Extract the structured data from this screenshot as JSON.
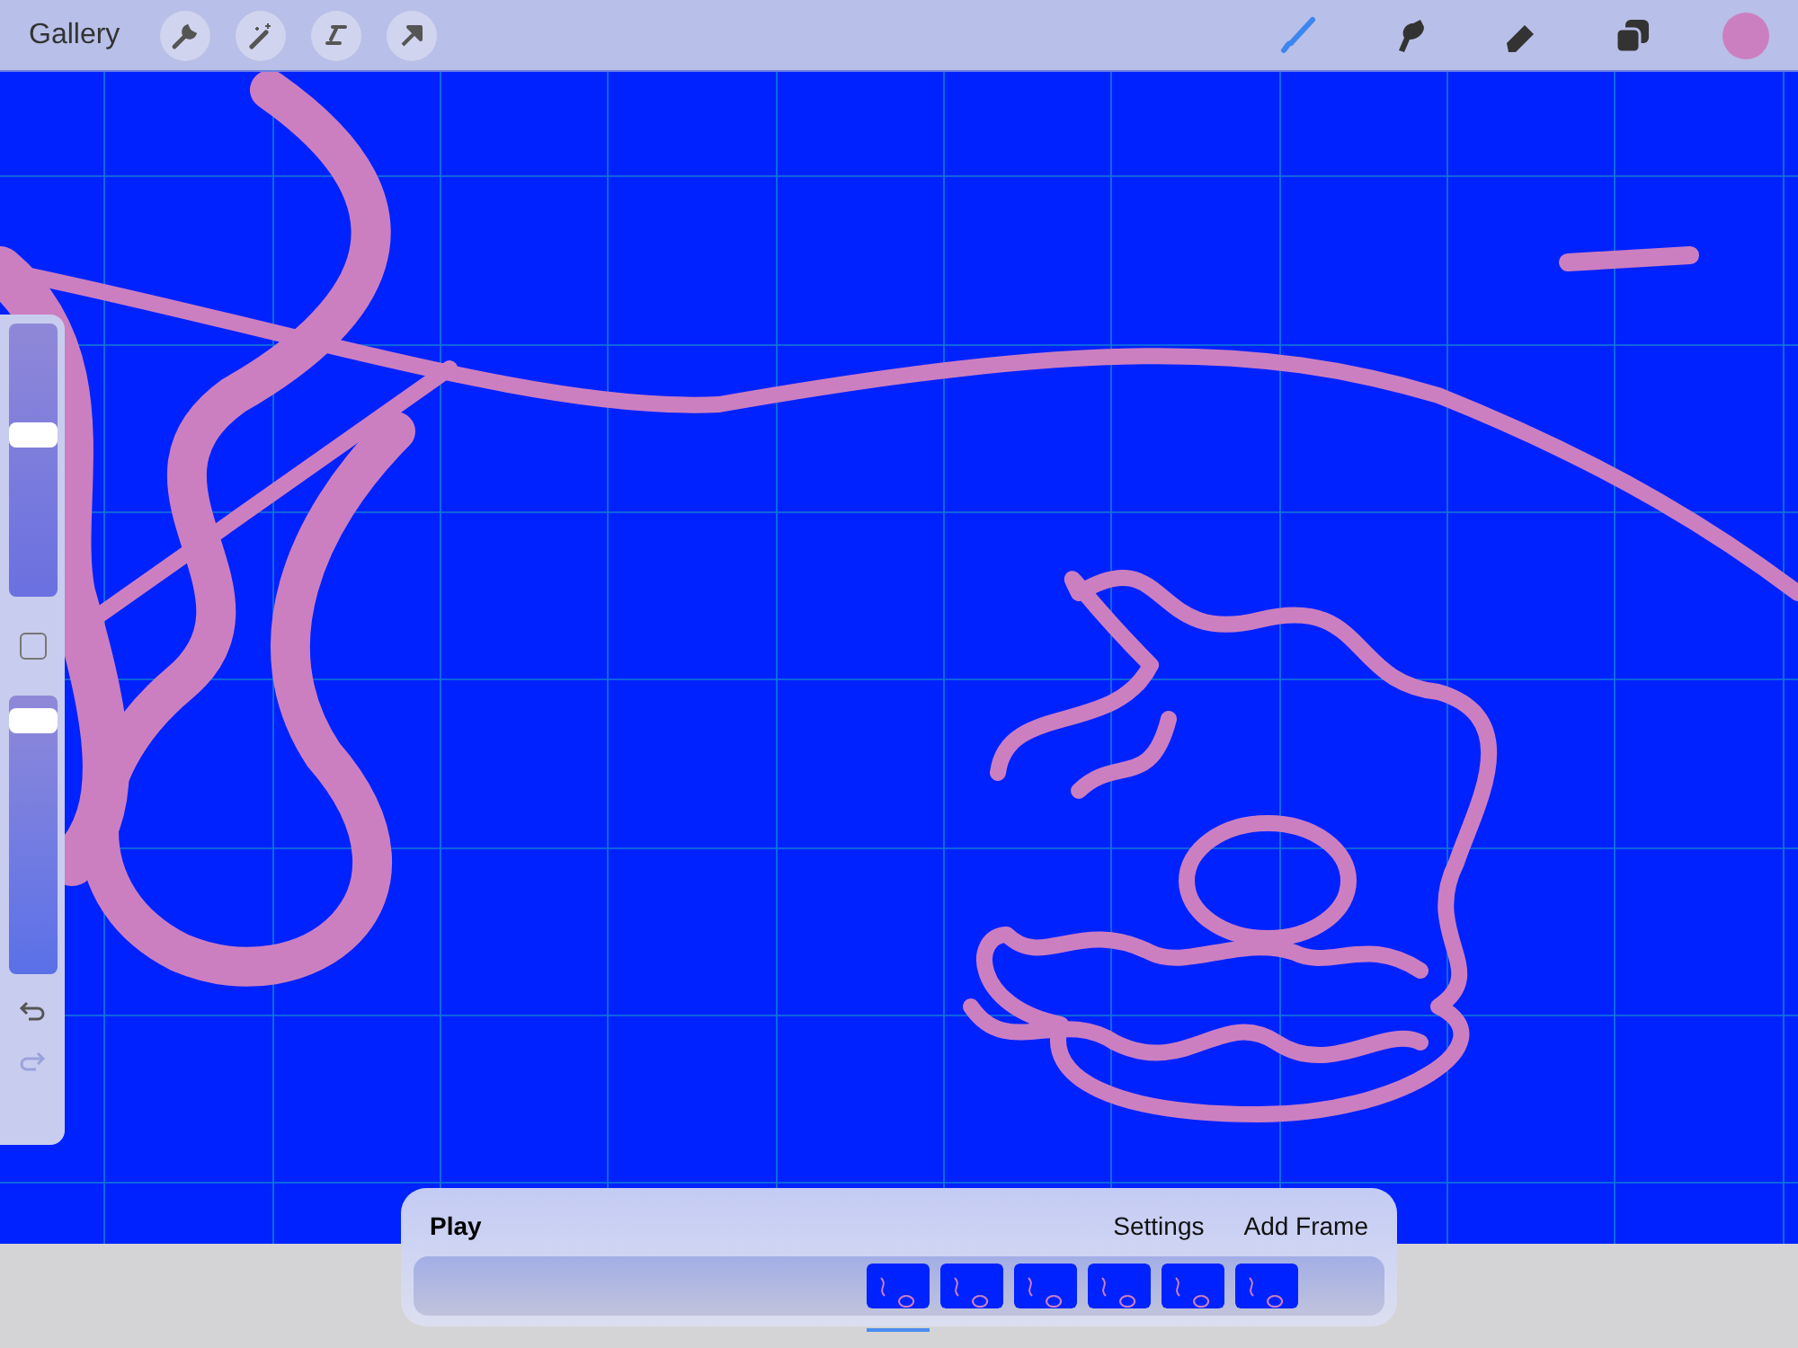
{
  "top_bar": {
    "gallery": "Gallery",
    "tools": [
      {
        "kind": "brush",
        "selected": true
      },
      {
        "kind": "smudge",
        "selected": false
      },
      {
        "kind": "eraser",
        "selected": false
      },
      {
        "kind": "layers",
        "selected": false
      }
    ],
    "color": "#cc7fc0"
  },
  "sidebar": {
    "brush_size": {
      "level": 0.6
    },
    "opacity": {
      "level": 0.95
    },
    "undo": {
      "disabled": false
    },
    "redo": {
      "disabled": true
    }
  },
  "animation_panel": {
    "play": "Play",
    "settings": "Settings",
    "add_frame": "Add Frame",
    "frames": [
      {
        "selected": true
      },
      {
        "selected": false
      },
      {
        "selected": false
      },
      {
        "selected": false
      },
      {
        "selected": false
      },
      {
        "selected": false
      }
    ]
  }
}
